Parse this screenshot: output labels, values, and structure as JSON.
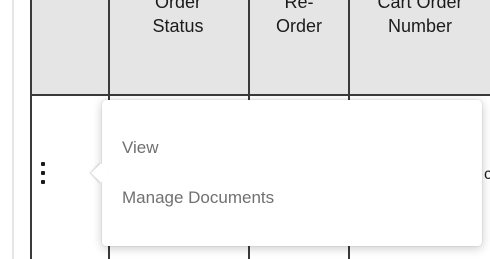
{
  "table": {
    "columns": [
      {
        "line1": "Order",
        "line2": "Status"
      },
      {
        "line1": "Re-",
        "line2": "Order"
      },
      {
        "line1": "Cart Order",
        "line2": "Number"
      }
    ]
  },
  "row": {
    "trailing_fragment": "c"
  },
  "menu": {
    "items": [
      {
        "label": "View"
      },
      {
        "label": "Manage Documents"
      }
    ]
  }
}
